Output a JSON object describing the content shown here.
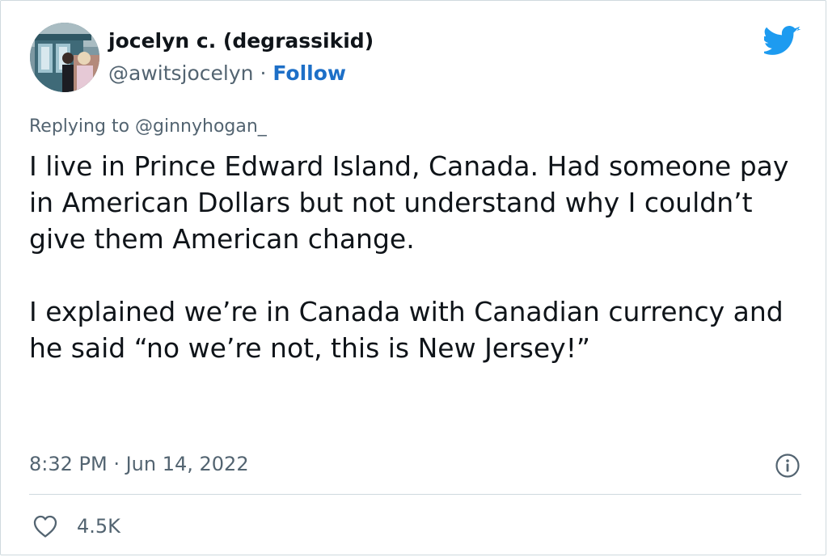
{
  "author": {
    "display_name": "jocelyn c. (degrassikid)",
    "handle": "@awitsjocelyn",
    "separator": " · ",
    "follow_label": "Follow",
    "avatar_icon": "profile-photo"
  },
  "reply": {
    "prefix": "Replying to ",
    "to_handle": "@ginnyhogan_"
  },
  "body": {
    "paragraph_1": "I live in Prince Edward Island, Canada. Had someone pay in American Dollars but not understand why I couldn’t give them American change.",
    "paragraph_2": "I explained we’re in Canada with Canadian currency and he said “no we’re not, this is New Jersey!”"
  },
  "meta": {
    "timestamp": "8:32 PM · Jun 14, 2022",
    "info_icon": "info-icon"
  },
  "engagement": {
    "likes": "4.5K",
    "like_icon": "heart-icon"
  },
  "colors": {
    "twitter_blue": "#1d9bf0",
    "follow_blue": "#1d6fc7",
    "secondary_text": "#536471",
    "primary_text": "#0f1419",
    "divider": "#cfd9de"
  }
}
